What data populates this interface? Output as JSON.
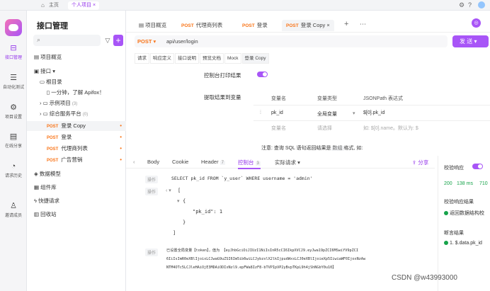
{
  "topbar": {
    "home": "主页",
    "tab_personal": "个人项目"
  },
  "rail": [
    {
      "label": "接口管理",
      "icon": "api-icon"
    },
    {
      "label": "自动化测试",
      "icon": "automation-icon"
    },
    {
      "label": "项目设置",
      "icon": "settings-icon"
    },
    {
      "label": "在线分享",
      "icon": "share-icon"
    },
    {
      "label": "请求历史",
      "icon": "history-icon"
    },
    {
      "label": "邀请成员",
      "icon": "invite-icon"
    }
  ],
  "tree": {
    "title": "接口管理",
    "items": [
      {
        "label": "项目概览",
        "kind": "icon"
      },
      {
        "label": "接口",
        "kind": "folder"
      },
      {
        "label": "根目录",
        "kind": "folder"
      },
      {
        "label": "一分钟，了解 Apifox！",
        "kind": "doc"
      },
      {
        "label": "示例项目",
        "count": "(3)",
        "kind": "folder"
      },
      {
        "label": "综合服务平台",
        "count": "(0)",
        "kind": "folder"
      },
      {
        "label": "登录 Copy",
        "method": "POST"
      },
      {
        "label": "登录",
        "method": "POST"
      },
      {
        "label": "代理商列表",
        "method": "POST"
      },
      {
        "label": "广告营销",
        "method": "POST"
      },
      {
        "label": "数据模型",
        "kind": "folder"
      },
      {
        "label": "组件库",
        "kind": "folder"
      },
      {
        "label": "快捷请求",
        "kind": "folder"
      },
      {
        "label": "回收站",
        "kind": "folder"
      }
    ]
  },
  "tabs": [
    {
      "label": "项目概览"
    },
    {
      "method": "POST",
      "label": "代理商列表"
    },
    {
      "method": "POST",
      "label": "登录"
    },
    {
      "method": "POST",
      "label": "登录 Copy"
    }
  ],
  "request": {
    "method": "POST",
    "url": "api/user/login",
    "send": "发 送"
  },
  "req_tabs": [
    "请求",
    "响应定义",
    "接口说明",
    "预览文档",
    "Mock",
    "登录 Copy"
  ],
  "settings": {
    "console_print": "控制台打印结果",
    "extract_label": "提取结果到变量"
  },
  "extract": {
    "headers": [
      "变量名",
      "变量类型",
      "JSONPath 表达式"
    ],
    "row": [
      "pk_id",
      "全局变量",
      "$[0].pk_id"
    ],
    "placeholders": [
      "变量名",
      "请选择",
      "如: $[0].name。默认为: $"
    ]
  },
  "note": {
    "prefix": "注意: 查询 SQL 语句返回结果是",
    "code": "数组",
    "suffix": "格式, 如:"
  },
  "resp_tabs": [
    {
      "label": "Body"
    },
    {
      "label": "Cookie"
    },
    {
      "label": "Header",
      "badge": "7"
    },
    {
      "label": "控制台",
      "badge": "3"
    },
    {
      "label": "实际请求"
    }
  ],
  "share": "分享",
  "console": {
    "op_label": "操作",
    "sql": "SELECT pk_id FROM `y_user` WHERE username = 'admin'",
    "json_lines": [
      "[",
      "{",
      "\"pk_id\": 1",
      "}",
      "]"
    ],
    "var_line1": "已设置全局变量【token】，值为 【eyJhbGciOiJIUzI1NiIsInR5cCI6IkpXVCJ9.eyJwa19pZCI6MSwiYV9pZCI",
    "var_line2": "6IiIsImR0eXBlIjoixLCJwaG9uZSI6Im5ib6wiLCJybzxlX2lkIjpudWxsLCJ0eXBlIjoieXp5IiwiaWF0IjoxNzAw",
    "var_line3": "NTM4OTc5LCJleHAiOjE3MDAiODIxNzl9.epFWa8IzF8-bTVPIpVP2yBvpTKpL9h4jShNGbY0u10】"
  },
  "side": {
    "validate": "校验响应",
    "status": "200",
    "time": "138 ms",
    "size": "710",
    "result_title": "校验响应结果",
    "result": "返回数据结构校",
    "assert_title": "断言结果",
    "assert": "1. $.data.pk_id"
  },
  "watermark": "CSDN @w43993000"
}
